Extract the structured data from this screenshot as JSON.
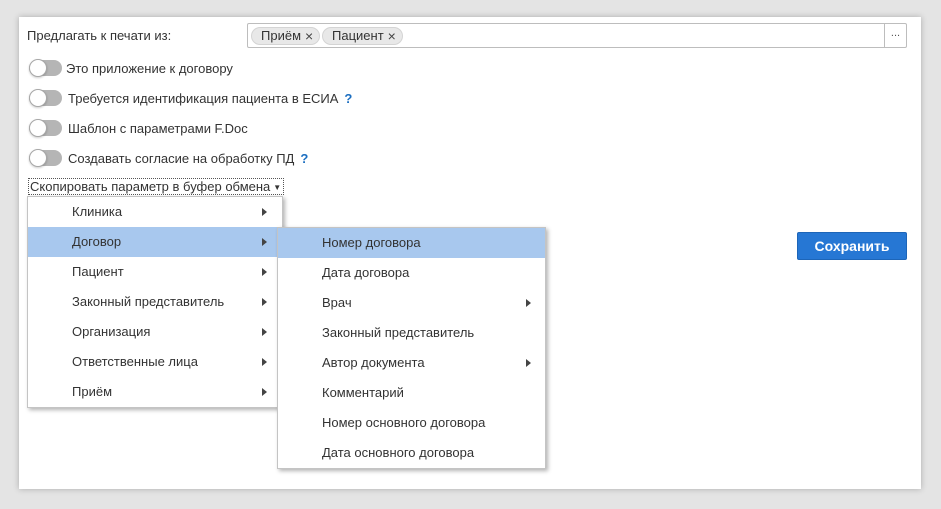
{
  "print_from": {
    "label": "Предлагать к печати из:",
    "chips": [
      "Приём",
      "Пациент"
    ],
    "chip_close": "×",
    "dots": "..."
  },
  "toggles": [
    {
      "label": "Это приложение к договору",
      "help": "",
      "on": false
    },
    {
      "label": "Требуется идентификация пациента в ЕСИА",
      "help": "?",
      "on": false
    },
    {
      "label": "Шаблон с параметрами F.Doc",
      "help": "",
      "on": false
    },
    {
      "label": "Создавать согласие на обработку ПД",
      "help": "?",
      "on": false
    }
  ],
  "copy_button": {
    "label": "Скопировать параметр в буфер обмена",
    "caret": "▼"
  },
  "save_button": {
    "label": "Сохранить"
  },
  "menu": {
    "items": [
      "Клиника",
      "Договор",
      "Пациент",
      "Законный представитель",
      "Организация",
      "Ответственные лица",
      "Приём"
    ],
    "active": "Договор"
  },
  "submenu": {
    "items": [
      {
        "label": "Номер договора",
        "has_sub": false
      },
      {
        "label": "Дата договора",
        "has_sub": false
      },
      {
        "label": "Врач",
        "has_sub": true
      },
      {
        "label": "Законный представитель",
        "has_sub": false
      },
      {
        "label": "Автор документа",
        "has_sub": true
      },
      {
        "label": "Комментарий",
        "has_sub": false
      },
      {
        "label": "Номер основного договора",
        "has_sub": false
      },
      {
        "label": "Дата основного договора",
        "has_sub": false
      }
    ],
    "active": "Номер договора"
  },
  "colors": {
    "accent": "#2677d4",
    "highlight": "#a8c8ee",
    "help": "#1c6fc1"
  }
}
